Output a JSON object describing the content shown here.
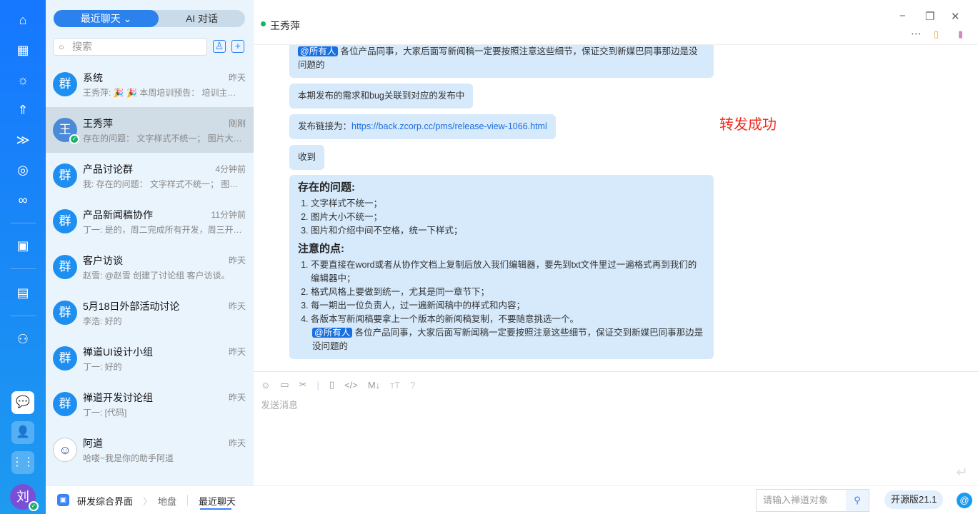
{
  "rail": {
    "user_initial": "刘"
  },
  "list": {
    "tab_recent": "最近聊天",
    "tab_ai": "AI 对话",
    "search_placeholder": "搜索",
    "items": [
      {
        "avatar": "群",
        "name": "系统",
        "time": "昨天",
        "preview": "王秀萍: 🎉 🎉 本周培训预告： 培训主…"
      },
      {
        "avatar": "王",
        "name": "王秀萍",
        "time": "刚刚",
        "preview": "存在的问题： 文字样式不统一； 图片大…"
      },
      {
        "avatar": "群",
        "name": "产品讨论群",
        "time": "4分钟前",
        "preview": "我: 存在的问题： 文字样式不统一； 图…"
      },
      {
        "avatar": "群",
        "name": "产品新闻稿协作",
        "time": "11分钟前",
        "preview": "丁一: 是的，周二完成所有开发，周三开…"
      },
      {
        "avatar": "群",
        "name": "客户访谈",
        "time": "昨天",
        "preview": "赵雪: @赵雪 创建了讨论组 客户访谈。"
      },
      {
        "avatar": "群",
        "name": "5月18日外部活动讨论",
        "time": "昨天",
        "preview": "李浩: 好的"
      },
      {
        "avatar": "群",
        "name": "禅道UI设计小组",
        "time": "昨天",
        "preview": "丁一: 好的"
      },
      {
        "avatar": "群",
        "name": "禅道开发讨论组",
        "time": "昨天",
        "preview": "丁一: [代码]"
      },
      {
        "avatar": "☺",
        "name": "阿道",
        "time": "昨天",
        "preview": "哈喽~我是你的助手阿道"
      }
    ]
  },
  "chat": {
    "title": "王秀萍",
    "m1_at": "@所有人",
    "m1_text": " 各位产品同事，大家后面写新闻稿一定要按照注意这些细节，保证交到新媒巴同事那边是没问题的",
    "m2": "本期发布的需求和bug关联到对应的发布中",
    "m3_label": "发布链接为：",
    "m3_link": "https://back.zcorp.cc/pms/release-view-1066.html",
    "m4": "收到",
    "m5_h1": "存在的问题:",
    "m5_l1": [
      "文字样式不统一；",
      "图片大小不统一；",
      "图片和介绍中间不空格，统一下样式；"
    ],
    "m5_h2": "注意的点:",
    "m5_l2": [
      "不要直接在word或者从协作文档上复制后放入我们编辑器，要先到txt文件里过一遍格式再到我们的编辑器中；",
      "格式风格上要做到统一，尤其是同一章节下；",
      "每一期出一位负责人，过一遍新闻稿中的样式和内容；",
      "各版本写新闻稿要拿上一个版本的新闻稿复制，不要随意挑选一个。"
    ],
    "m5_at": "@所有人",
    "m5_tail": " 各位产品同事，大家后面写新闻稿一定要按照注意这些细节，保证交到新媒巴同事那边是没问题的",
    "toast": "转发成功",
    "input_placeholder": "发送消息"
  },
  "footer": {
    "app": "研发综合界面",
    "crumb1": "地盘",
    "crumb2": "最近聊天",
    "search_placeholder": "请输入禅道对象",
    "version": "开源版21.1"
  }
}
